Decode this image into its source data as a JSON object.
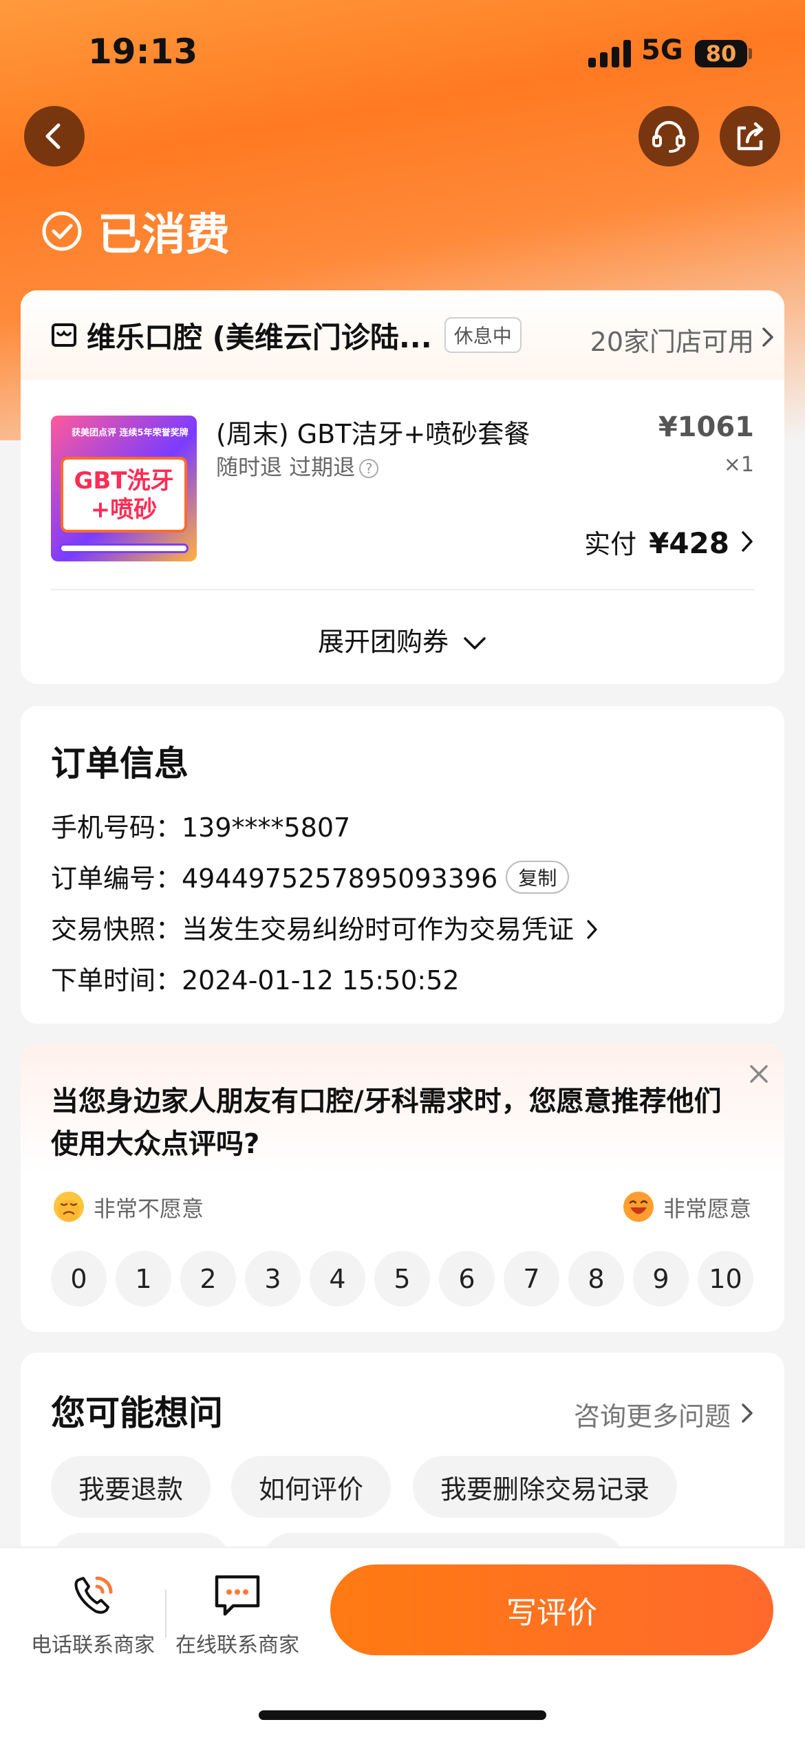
{
  "status_bar": {
    "time": "19:13",
    "network": "5G",
    "battery": "80"
  },
  "header": {
    "status_title": "已消费"
  },
  "shop": {
    "name": "维乐口腔 (美维云门诊陆...",
    "badge": "休息中",
    "stores": "20家门店可用"
  },
  "deal": {
    "thumb_top": "获美团点评 连续5年荣誉奖牌",
    "thumb_text_1": "GBT洗牙",
    "thumb_text_2": "+喷砂",
    "name": "(周末) GBT洁牙+喷砂套餐",
    "refund": "随时退 过期退",
    "help_mark": "?",
    "orig_price": "¥1061",
    "qty": "×1",
    "paid_label": "实付",
    "paid_price": "¥428",
    "expand_label": "展开团购券"
  },
  "order": {
    "title": "订单信息",
    "phone": "手机号码：139****5807",
    "number": "订单编号：4944975257895093396",
    "copy_label": "复制",
    "snapshot": "交易快照：当发生交易纠纷时可作为交易凭证",
    "time": "下单时间：2024-01-12 15:50:52"
  },
  "survey": {
    "question": "当您身边家人朋友有口腔/牙科需求时，您愿意推荐他们使用大众点评吗?",
    "low_label": "非常不愿意",
    "high_label": "非常愿意",
    "scores": [
      "0",
      "1",
      "2",
      "3",
      "4",
      "5",
      "6",
      "7",
      "8",
      "9",
      "10"
    ]
  },
  "faq": {
    "title": "您可能想问",
    "more": "咨询更多问题",
    "chips": [
      "我要退款",
      "如何评价",
      "我要删除交易记录"
    ]
  },
  "bottom": {
    "call_label": "电话联系商家",
    "chat_label": "在线联系商家",
    "review_label": "写评价"
  },
  "colors": {
    "accent": "#ff7a12",
    "hero": "#ff8a3a"
  }
}
